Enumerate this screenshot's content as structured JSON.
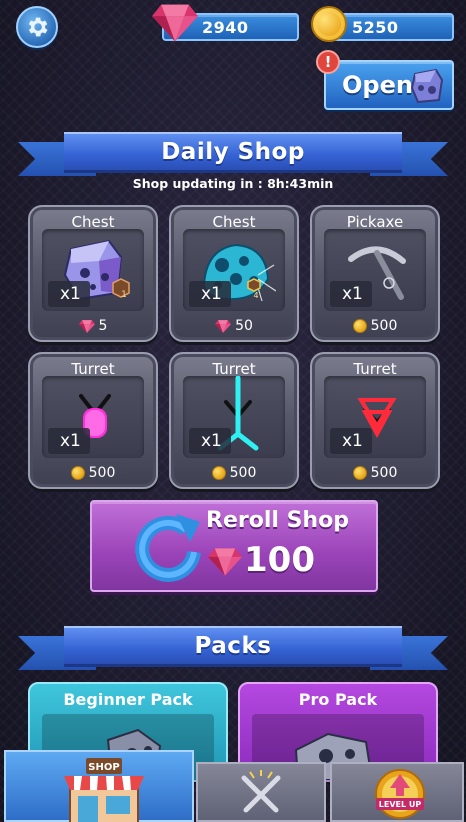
{
  "header": {
    "settings_icon": "gear-icon",
    "gems": "2940",
    "coins": "5250",
    "open_label": "Open",
    "alert_badge": "!"
  },
  "daily_shop": {
    "title": "Daily Shop",
    "timer": "Shop updating in : 8h:43min",
    "items": [
      {
        "name": "Chest",
        "qty": "x1",
        "price": "5",
        "currency": "gems",
        "level_badge": "1",
        "icon": "purple-chest-icon"
      },
      {
        "name": "Chest",
        "qty": "x1",
        "price": "50",
        "currency": "gems",
        "level_badge": "4",
        "icon": "blue-chest-icon"
      },
      {
        "name": "Pickaxe",
        "qty": "x1",
        "price": "500",
        "currency": "coins",
        "icon": "pickaxe-icon"
      },
      {
        "name": "Turret",
        "qty": "x1",
        "price": "500",
        "currency": "coins",
        "icon": "pink-turret-icon"
      },
      {
        "name": "Turret",
        "qty": "x1",
        "price": "500",
        "currency": "coins",
        "icon": "cyan-turret-icon"
      },
      {
        "name": "Turret",
        "qty": "x1",
        "price": "500",
        "currency": "coins",
        "icon": "red-turret-icon"
      }
    ],
    "reroll": {
      "label": "Reroll Shop",
      "cost": "100"
    }
  },
  "packs": {
    "title": "Packs",
    "items": [
      {
        "name": "Beginner Pack"
      },
      {
        "name": "Pro Pack"
      }
    ]
  },
  "bottom_nav": {
    "shop_sign": "SHOP",
    "levelup_label": "LEVEL UP",
    "tabs": [
      "shop-icon",
      "crossed-swords-icon",
      "level-up-icon"
    ]
  },
  "colors": {
    "gem": "#e0457b",
    "coin": "#f2b61f",
    "accent_blue": "#3a74d8",
    "reroll_purple": "#9a43b8"
  }
}
